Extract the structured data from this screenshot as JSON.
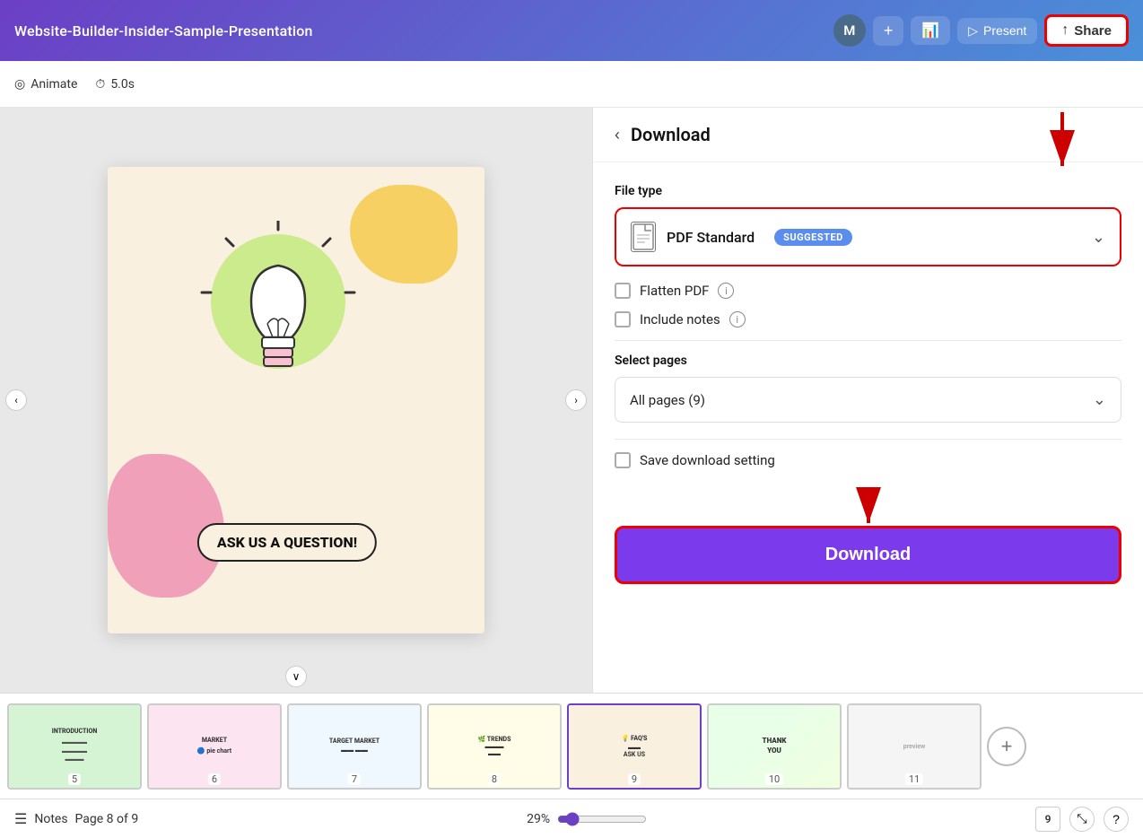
{
  "header": {
    "title": "Website-Builder-Insider-Sample-Presentation",
    "avatar_initial": "M",
    "plus_label": "+",
    "analytics_label": "Analytics",
    "present_label": "Present",
    "share_label": "Share"
  },
  "sub_toolbar": {
    "animate_label": "Animate",
    "duration_label": "5.0s"
  },
  "download_panel": {
    "back_label": "‹",
    "title": "Download",
    "file_type_label": "File type",
    "file_type_value": "PDF Standard",
    "suggested_badge": "SUGGESTED",
    "flatten_pdf_label": "Flatten PDF",
    "include_notes_label": "Include notes",
    "select_pages_label": "Select pages",
    "all_pages_label": "All pages (9)",
    "save_setting_label": "Save download setting",
    "download_button_label": "Download"
  },
  "canvas": {
    "ask_question_label": "ASK US A\nQUESTION!"
  },
  "status_bar": {
    "notes_label": "Notes",
    "page_info": "Page 8 of 9",
    "zoom_percent": "29%",
    "page_count": "9"
  },
  "filmstrip": {
    "slides": [
      {
        "number": "5",
        "type": "green",
        "label": "INTRODUCTION"
      },
      {
        "number": "6",
        "type": "pink",
        "label": "MARKET"
      },
      {
        "number": "7",
        "type": "light",
        "label": "TARGET MARKET"
      },
      {
        "number": "8",
        "type": "yellow",
        "label": "TRENDS"
      },
      {
        "number": "9",
        "type": "cream",
        "label": "FAQ'S",
        "active": true
      },
      {
        "number": "10",
        "type": "thankyou",
        "label": "THANK YOU"
      },
      {
        "number": "11",
        "type": "preview",
        "label": ""
      }
    ]
  }
}
